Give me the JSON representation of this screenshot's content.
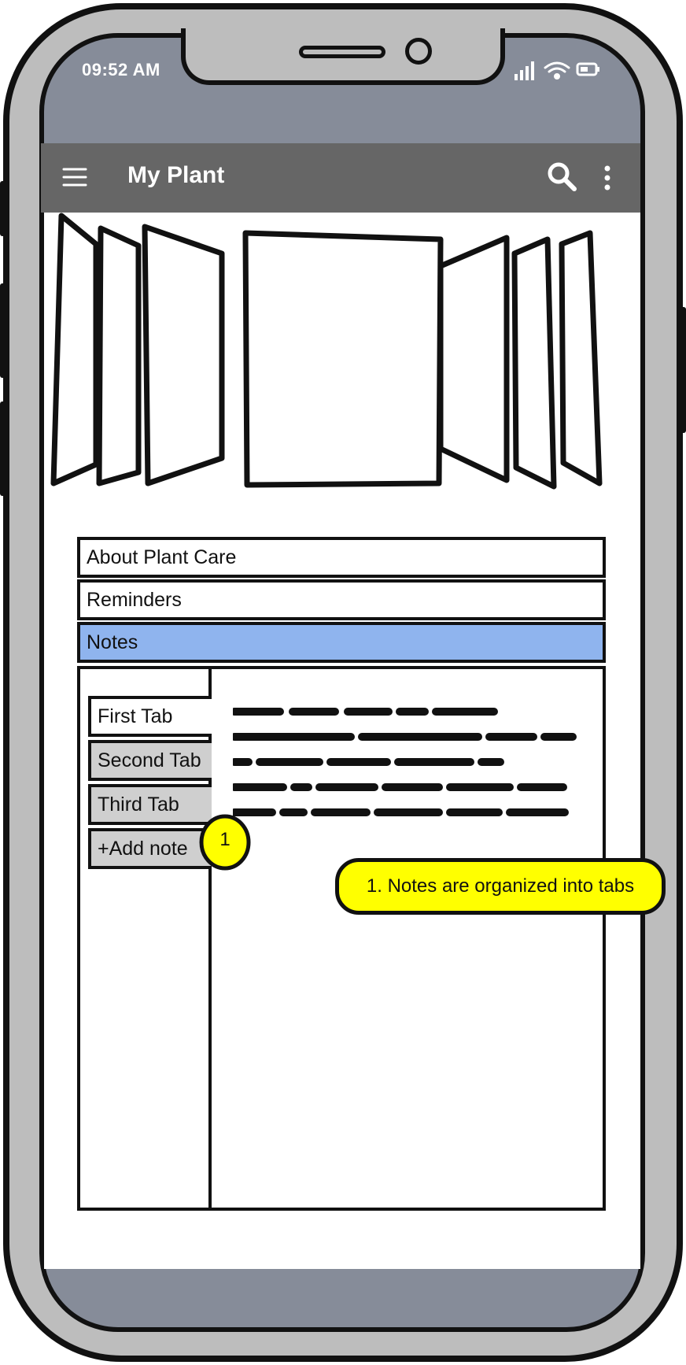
{
  "status_bar": {
    "time": "09:52 AM"
  },
  "app_bar": {
    "title": "My Plant"
  },
  "accordion": {
    "items": [
      {
        "label": "About Plant Care",
        "active": false
      },
      {
        "label": "Reminders",
        "active": false
      },
      {
        "label": "Notes",
        "active": true
      }
    ]
  },
  "notes_tabs": {
    "tabs": [
      {
        "label": "First Tab",
        "selected": true
      },
      {
        "label": "Second Tab",
        "selected": false
      },
      {
        "label": "Third Tab",
        "selected": false
      },
      {
        "label": "+Add note",
        "selected": false
      }
    ]
  },
  "annotation": {
    "badge": "1",
    "callout": "1. Notes are organized into tabs"
  },
  "colors": {
    "app_bar": "#666666",
    "active_section": "#8fb4ee",
    "annotation": "#ffff00",
    "phone_screen_edge": "#868c99"
  },
  "icons": [
    "menu-icon",
    "search-icon",
    "more-vert-icon",
    "signal-icon",
    "wifi-icon",
    "battery-icon"
  ]
}
